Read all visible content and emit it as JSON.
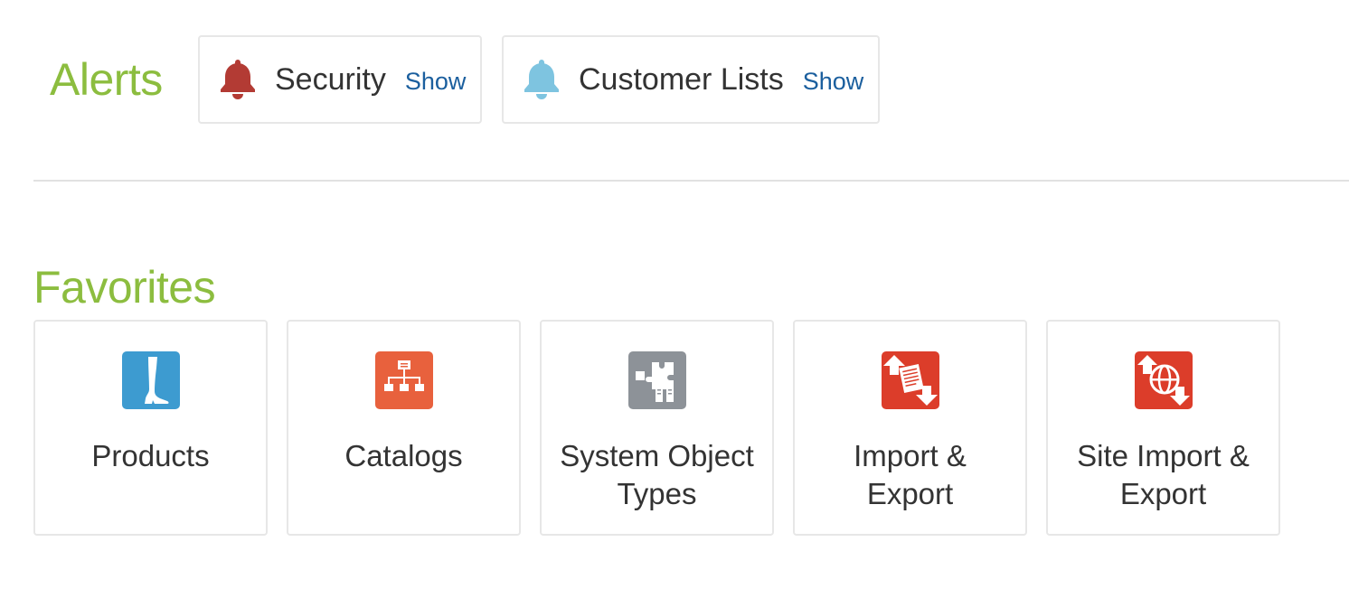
{
  "alerts": {
    "heading": "Alerts",
    "items": [
      {
        "label": "Security",
        "action": "Show",
        "icon": "bell-icon",
        "color": "#b33b34"
      },
      {
        "label": "Customer Lists",
        "action": "Show",
        "icon": "bell-icon",
        "color": "#7ec4e0"
      }
    ]
  },
  "favorites": {
    "heading": "Favorites",
    "items": [
      {
        "label": "Products",
        "icon": "boot-icon",
        "color": "#3d9bd0"
      },
      {
        "label": "Catalogs",
        "icon": "hierarchy-icon",
        "color": "#e8613d"
      },
      {
        "label": "System Object Types",
        "icon": "puzzle-icon",
        "color": "#8d9298"
      },
      {
        "label": "Import & Export",
        "icon": "import-export-icon",
        "color": "#dc3d2a"
      },
      {
        "label": "Site Import & Export",
        "icon": "site-import-export-icon",
        "color": "#dc3d2a"
      }
    ]
  },
  "colors": {
    "heading": "#8cbd3f",
    "link": "#1b5f9e",
    "text": "#333333",
    "border": "#e7e7e7"
  }
}
